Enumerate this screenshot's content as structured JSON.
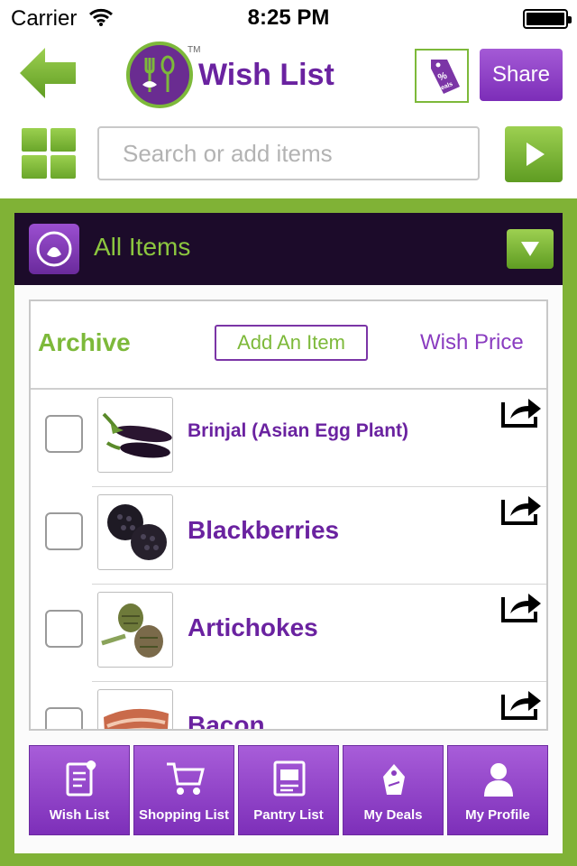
{
  "status_bar": {
    "carrier": "Carrier",
    "time": "8:25 PM"
  },
  "header": {
    "title": "Wish List",
    "trademark": "TM",
    "deals_label": "Deals",
    "deals_symbol": "%",
    "share_label": "Share",
    "search_placeholder": "Search or add items"
  },
  "section": {
    "title": "All Items"
  },
  "tabs": {
    "archive": "Archive",
    "add_item": "Add An Item",
    "wish_price": "Wish Price"
  },
  "items": [
    {
      "name": "Brinjal (Asian Egg Plant)",
      "checked": false,
      "thumb": "brinjal"
    },
    {
      "name": "Blackberries",
      "checked": false,
      "thumb": "blackberries"
    },
    {
      "name": "Artichokes",
      "checked": false,
      "thumb": "artichokes"
    },
    {
      "name": "Bacon",
      "checked": false,
      "thumb": "bacon"
    }
  ],
  "bottom_nav": [
    {
      "label": "Wish List",
      "icon": "wish-list-icon"
    },
    {
      "label": "Shopping List",
      "icon": "shopping-cart-icon"
    },
    {
      "label": "Pantry List",
      "icon": "pantry-list-icon"
    },
    {
      "label": "My Deals",
      "icon": "deals-icon"
    },
    {
      "label": "My Profile",
      "icon": "profile-icon"
    }
  ],
  "colors": {
    "brand_purple": "#6a22a0",
    "brand_green": "#80b236",
    "nav_purple": "#9a4fd0",
    "dark_bar": "#1c0b2a"
  }
}
